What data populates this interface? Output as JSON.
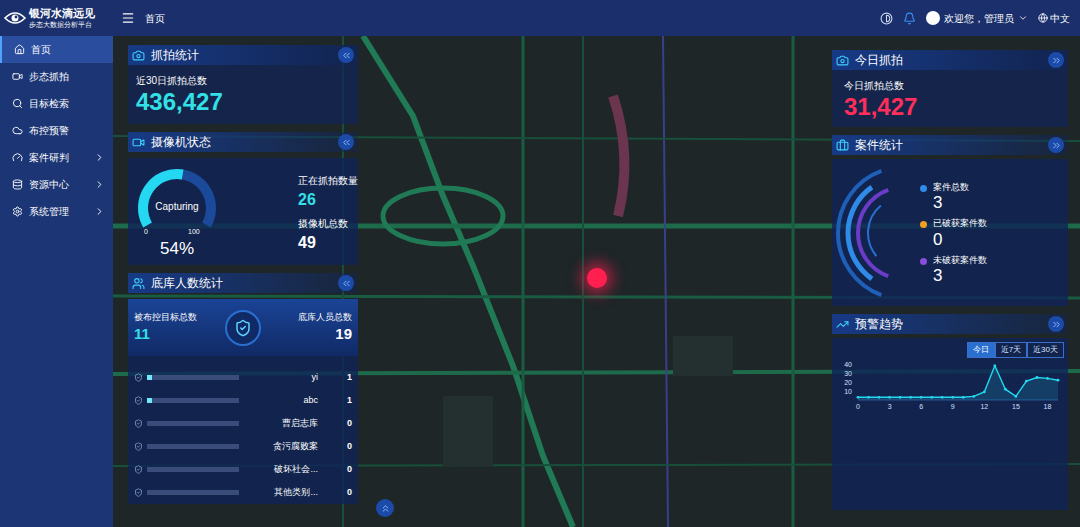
{
  "brand": {
    "title": "银河水滴远见",
    "subtitle": "步态大数据分析平台"
  },
  "header": {
    "breadcrumb": "首页",
    "user": "欢迎您，管理员",
    "language": "中文"
  },
  "sidebar": {
    "items": [
      {
        "label": "首页",
        "selected": true,
        "expandable": false
      },
      {
        "label": "步态抓拍",
        "selected": false,
        "expandable": false
      },
      {
        "label": "目标检索",
        "selected": false,
        "expandable": false
      },
      {
        "label": "布控预警",
        "selected": false,
        "expandable": false
      },
      {
        "label": "案件研判",
        "selected": false,
        "expandable": true
      },
      {
        "label": "资源中心",
        "selected": false,
        "expandable": true
      },
      {
        "label": "系统管理",
        "selected": false,
        "expandable": true
      }
    ]
  },
  "capture_stats": {
    "title": "抓拍统计",
    "label": "近30日抓拍总数",
    "value": "436,427"
  },
  "camera_status": {
    "title": "摄像机状态",
    "gauge_label": "Capturing",
    "min": "0",
    "max": "100",
    "percent": "54%",
    "level": 0.54,
    "capturing_label": "正在抓拍数量",
    "capturing_value": "26",
    "total_label": "摄像机总数",
    "total_value": "49"
  },
  "library_stats": {
    "title": "底库人数统计",
    "targets_label": "被布控目标总数",
    "targets_value": "11",
    "persons_label": "底库人员总数",
    "persons_value": "19",
    "rows": [
      {
        "name": "yi",
        "count": "1",
        "level": 0.05
      },
      {
        "name": "abc",
        "count": "1",
        "level": 0.05
      },
      {
        "name": "曹启志库",
        "count": "0",
        "level": 0
      },
      {
        "name": "贪污腐败案",
        "count": "0",
        "level": 0
      },
      {
        "name": "破坏社会...",
        "count": "0",
        "level": 0
      },
      {
        "name": "其他类别...",
        "count": "0",
        "level": 0
      }
    ]
  },
  "today_capture": {
    "title": "今日抓拍",
    "label": "今日抓拍总数",
    "value": "31,427"
  },
  "case_stats": {
    "title": "案件统计",
    "items": [
      {
        "label": "案件总数",
        "value": "3",
        "color": "#2f8ae8"
      },
      {
        "label": "已破获案件数",
        "value": "0",
        "color": "#f0a020"
      },
      {
        "label": "未破获案件数",
        "value": "3",
        "color": "#8a4de0"
      }
    ]
  },
  "alert_trend": {
    "title": "预警趋势",
    "tabs": [
      {
        "label": "今日",
        "selected": true
      },
      {
        "label": "近7天",
        "selected": false
      },
      {
        "label": "近30天",
        "selected": false
      }
    ],
    "y_ticks": [
      "40",
      "30",
      "20",
      "10"
    ],
    "x_ticks": [
      "0",
      "3",
      "6",
      "9",
      "12",
      "15",
      "18"
    ],
    "series": [
      {
        "values": [
          3,
          3,
          3,
          3,
          3,
          3,
          3,
          3,
          3,
          3,
          3,
          4,
          9,
          38,
          12,
          4,
          21,
          25,
          24,
          22
        ]
      }
    ]
  }
}
